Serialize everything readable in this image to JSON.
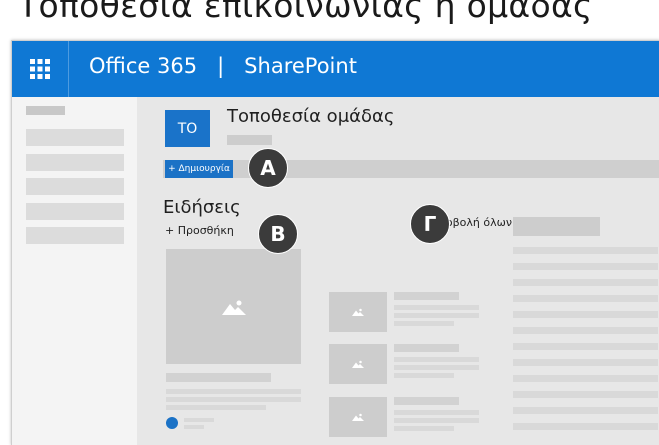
{
  "page_heading": "Τοποθεσία επικοινωνίας ή ομάδας",
  "suite_bar": {
    "app_launcher_icon": "waffle-grid-icon",
    "title": "Office 365   |   SharePoint",
    "color": "#0f78d4"
  },
  "site": {
    "logo_initials": "ΤΟ",
    "title": "Τοποθεσία ομάδας",
    "new_button_label": "+ Δημιουργία"
  },
  "news": {
    "title": "Ειδήσεις",
    "add_label": "+ Προσθήκη",
    "see_all_label": "προβολή όλων",
    "image_icon": "image-placeholder-icon",
    "author_icon": "person-icon"
  },
  "callouts": {
    "a": "A",
    "b": "B",
    "c": "Γ"
  },
  "accent_color": "#1b72c6"
}
